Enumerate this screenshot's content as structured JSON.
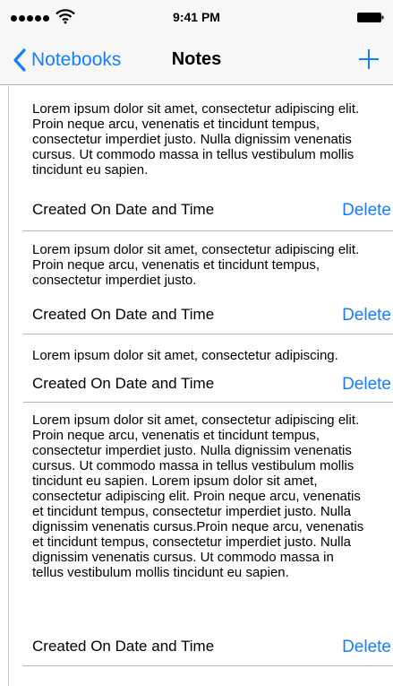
{
  "status_bar": {
    "time": "9:41 PM",
    "signal_icon": "signal-dots-icon",
    "wifi_icon": "wifi-icon",
    "battery_icon": "battery-icon"
  },
  "nav": {
    "back_label": "Notebooks",
    "back_icon": "chevron-left-icon",
    "title": "Notes",
    "add_icon": "plus-icon"
  },
  "colors": {
    "accent": "#147efb",
    "separator": "#b2b2b2",
    "bar_background": "#f7f7f7"
  },
  "notes": [
    {
      "text": "Lorem ipsum dolor sit amet, consectetur adipiscing elit. Proin neque arcu, venenatis et tincidunt tempus, consectetur imperdiet justo. Nulla dignissim venenatis cursus. Ut commodo massa in tellus vestibulum mollis tincidunt eu sapien.",
      "date": "Created On Date and Time",
      "delete_label": "Delete"
    },
    {
      "text": "Lorem ipsum dolor sit amet, consectetur adipiscing elit. Proin neque arcu, venenatis et tincidunt tempus, consectetur imperdiet justo.",
      "date": "Created On Date and Time",
      "delete_label": "Delete"
    },
    {
      "text": "Lorem ipsum dolor sit amet, consectetur adipiscing.",
      "date": "Created On Date and Time",
      "delete_label": "Delete"
    },
    {
      "text": "Lorem ipsum dolor sit amet, consectetur adipiscing elit. Proin neque arcu, venenatis et tincidunt tempus, consectetur imperdiet justo. Nulla dignissim venenatis cursus. Ut commodo massa in tellus vestibulum mollis tincidunt eu sapien. Lorem ipsum dolor sit amet, consectetur adipiscing elit. Proin neque arcu, venenatis et tincidunt tempus, consectetur imperdiet justo. Nulla dignissim venenatis cursus.Proin neque arcu, venenatis et tincidunt tempus, consectetur imperdiet justo. Nulla dignissim venenatis cursus. Ut commodo massa in tellus vestibulum mollis tincidunt eu sapien.",
      "date": "Created On Date and Time",
      "delete_label": "Delete"
    }
  ]
}
